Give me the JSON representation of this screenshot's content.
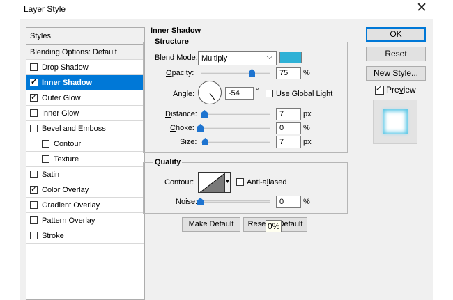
{
  "window": {
    "title": "Layer Style"
  },
  "styles_panel": {
    "header": "Styles",
    "blending_options": "Blending Options: Default",
    "items": [
      {
        "label": "Drop Shadow",
        "checked": false,
        "indent": false,
        "selected": false
      },
      {
        "label": "Inner Shadow",
        "checked": true,
        "indent": false,
        "selected": true
      },
      {
        "label": "Outer Glow",
        "checked": true,
        "indent": false,
        "selected": false
      },
      {
        "label": "Inner Glow",
        "checked": false,
        "indent": false,
        "selected": false
      },
      {
        "label": "Bevel and Emboss",
        "checked": false,
        "indent": false,
        "selected": false
      },
      {
        "label": "Contour",
        "checked": false,
        "indent": true,
        "selected": false
      },
      {
        "label": "Texture",
        "checked": false,
        "indent": true,
        "selected": false
      },
      {
        "label": "Satin",
        "checked": false,
        "indent": false,
        "selected": false
      },
      {
        "label": "Color Overlay",
        "checked": true,
        "indent": false,
        "selected": false
      },
      {
        "label": "Gradient Overlay",
        "checked": false,
        "indent": false,
        "selected": false
      },
      {
        "label": "Pattern Overlay",
        "checked": false,
        "indent": false,
        "selected": false
      },
      {
        "label": "Stroke",
        "checked": false,
        "indent": false,
        "selected": false
      }
    ]
  },
  "inner_shadow": {
    "title": "Inner Shadow",
    "structure": {
      "title": "Structure",
      "blend_mode_label": "Blend Mode:",
      "blend_mode_value": "Multiply",
      "shadow_color": "#2eb1d6",
      "opacity_label": "Opacity:",
      "opacity_value": "75",
      "opacity_fraction": 0.75,
      "opacity_unit": "%",
      "angle_label": "Angle:",
      "angle_value": "-54",
      "angle_unit": "°",
      "global_light_label": "Use Global Light",
      "global_light_checked": false,
      "distance_label": "Distance:",
      "distance_value": "7",
      "distance_unit": "px",
      "choke_label": "Choke:",
      "choke_value": "0",
      "choke_unit": "%",
      "size_label": "Size:",
      "size_value": "7",
      "size_unit": "px"
    },
    "quality": {
      "title": "Quality",
      "contour_label": "Contour:",
      "anti_aliased_label": "Anti-aliased",
      "anti_aliased_checked": false,
      "noise_label": "Noise:",
      "noise_value": "0",
      "noise_unit": "%"
    },
    "make_default_label": "Make Default",
    "reset_default_label": "Reset to Default"
  },
  "buttons": {
    "ok": "OK",
    "reset": "Reset",
    "new_style": "New Style...",
    "preview_label": "Preview",
    "preview_checked": true
  },
  "tooltip": "0%"
}
